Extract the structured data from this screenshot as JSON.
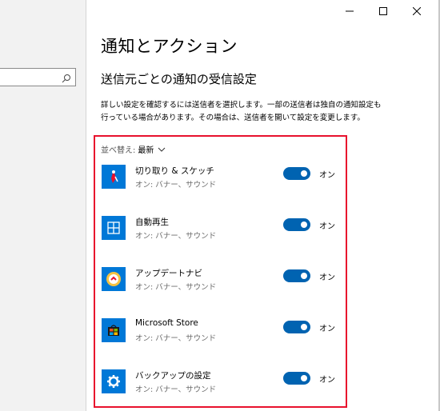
{
  "window": {
    "controls": [
      "minimize",
      "maximize",
      "close"
    ]
  },
  "sidebar": {
    "search": {
      "value": "",
      "icon": "search-icon"
    }
  },
  "page": {
    "title": "通知とアクション",
    "section_title": "送信元ごとの通知の受信設定",
    "description": "詳しい設定を確認するには送信者を選択します。一部の送信者は独自の通知設定も行っている場合があります。その場合は、送信者を開いて設定を変更します。"
  },
  "sort": {
    "label": "並べ替え:",
    "value": "最新"
  },
  "colors": {
    "accent": "#0063b1",
    "app_tile": "#0078d7",
    "highlight": "#e8112d"
  },
  "apps": [
    {
      "name": "切り取り & スケッチ",
      "sub": "オン: バナー、サウンド",
      "toggle_on": true,
      "toggle_label": "オン",
      "icon": "snip-sketch-icon"
    },
    {
      "name": "自動再生",
      "sub": "オン: バナー、サウンド",
      "toggle_on": true,
      "toggle_label": "オン",
      "icon": "autoplay-icon"
    },
    {
      "name": "アップデートナビ",
      "sub": "オン: バナー、サウンド",
      "toggle_on": true,
      "toggle_label": "オン",
      "icon": "update-navi-icon"
    },
    {
      "name": "Microsoft Store",
      "sub": "オン: バナー、サウンド",
      "toggle_on": true,
      "toggle_label": "オン",
      "icon": "microsoft-store-icon"
    },
    {
      "name": "バックアップの設定",
      "sub": "オン: バナー、サウンド",
      "toggle_on": true,
      "toggle_label": "オン",
      "icon": "gear-icon"
    }
  ]
}
